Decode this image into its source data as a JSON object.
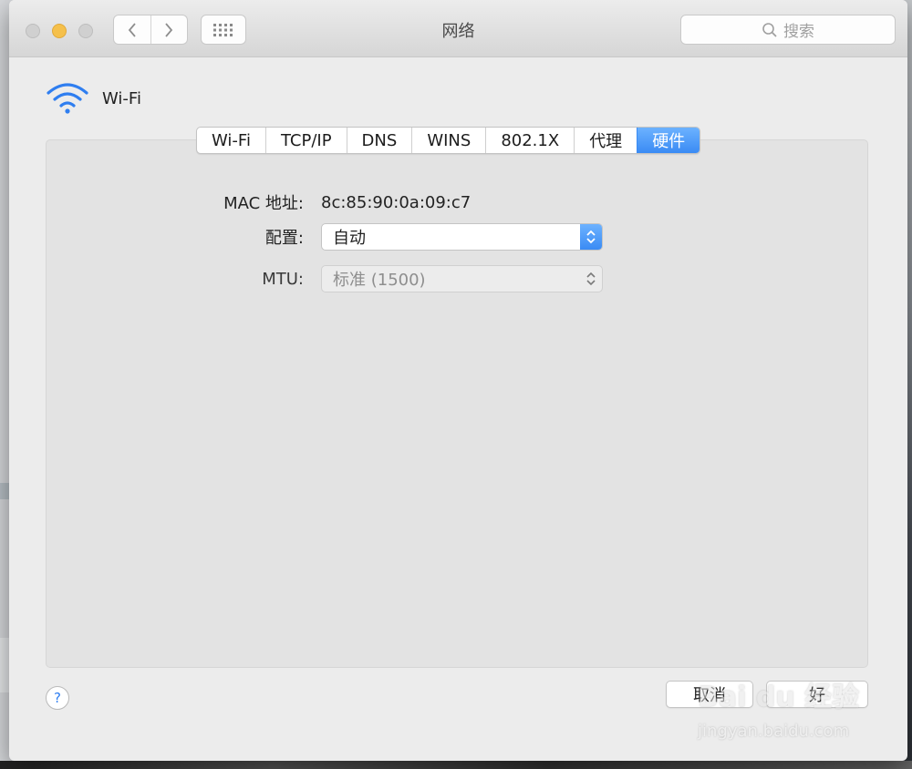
{
  "window": {
    "title": "网络",
    "search_placeholder": "搜索"
  },
  "interface": {
    "name": "Wi-Fi"
  },
  "tabs": [
    {
      "label": "Wi-Fi"
    },
    {
      "label": "TCP/IP"
    },
    {
      "label": "DNS"
    },
    {
      "label": "WINS"
    },
    {
      "label": "802.1X"
    },
    {
      "label": "代理"
    },
    {
      "label": "硬件",
      "active": true
    }
  ],
  "hardware": {
    "mac_label": "MAC 地址:",
    "mac_value": "8c:85:90:0a:09:c7",
    "config_label": "配置:",
    "config_value": "自动",
    "mtu_label": "MTU:",
    "mtu_value": "标准 (1500)"
  },
  "buttons": {
    "help": "?",
    "cancel": "取消",
    "ok": "好"
  },
  "watermark": {
    "main": "Bai du 经验",
    "sub": "jingyan.baidu.com"
  },
  "colors": {
    "accent": "#3a8bf4",
    "minimize": "#f5c04b",
    "wifi_icon": "#2f7ef0"
  }
}
